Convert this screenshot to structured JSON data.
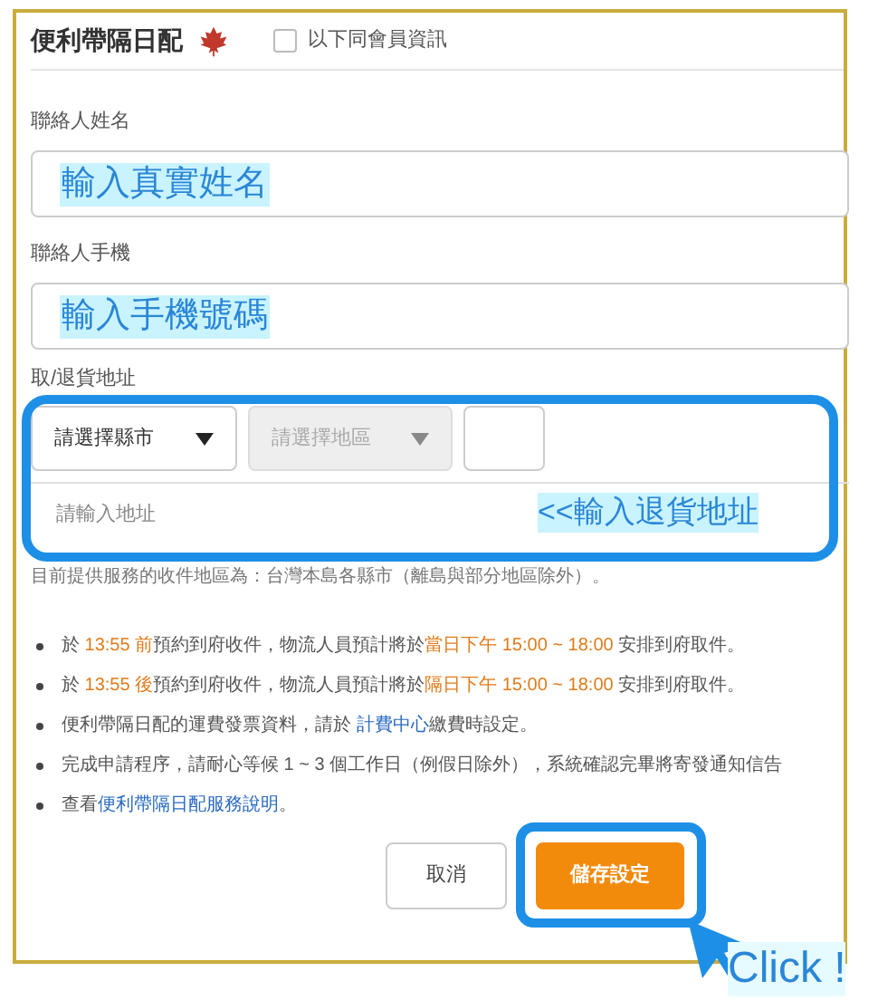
{
  "section": {
    "title": "便利帶隔日配",
    "same_as_member": {
      "label": "以下同會員資訊",
      "checked": false
    }
  },
  "name_field": {
    "label": "聯絡人姓名",
    "annotation": "輸入真實姓名"
  },
  "phone_field": {
    "label": "聯絡人手機",
    "annotation": "輸入手機號碼"
  },
  "address": {
    "label": "取/退貨地址",
    "city_select": {
      "value": "請選擇縣市",
      "disabled": false
    },
    "district_select": {
      "value": "請選擇地區",
      "disabled": true
    },
    "address_field": {
      "placeholder": "請輸入地址"
    },
    "annotation": "<<輸入退貨地址"
  },
  "service_note": "目前提供服務的收件地區為：台灣本島各縣市（離島與部分地區除外）。",
  "notes": [
    [
      {
        "text": "於 ",
        "kind": "plain"
      },
      {
        "text": "13:55 前",
        "kind": "highlight"
      },
      {
        "text": "預約到府收件，物流人員預計將於",
        "kind": "plain"
      },
      {
        "text": "當日下午 15:00 ~ 18:00",
        "kind": "highlight"
      },
      {
        "text": " 安排到府取件。",
        "kind": "plain"
      }
    ],
    [
      {
        "text": "於 ",
        "kind": "plain"
      },
      {
        "text": "13:55 後",
        "kind": "highlight"
      },
      {
        "text": "預約到府收件，物流人員預計將於",
        "kind": "plain"
      },
      {
        "text": "隔日下午 15:00 ~ 18:00",
        "kind": "highlight"
      },
      {
        "text": " 安排到府取件。",
        "kind": "plain"
      }
    ],
    [
      {
        "text": "便利帶隔日配的運費發票資料，請於 ",
        "kind": "plain"
      },
      {
        "text": "計費中心",
        "kind": "link"
      },
      {
        "text": "繳費時設定。",
        "kind": "plain"
      }
    ],
    [
      {
        "text": "完成申請程序，請耐心等候 1 ~ 3 個工作日（例假日除外），系統確認完畢將寄發通知信告",
        "kind": "plain"
      }
    ],
    [
      {
        "text": "查看",
        "kind": "plain"
      },
      {
        "text": "便利帶隔日配服務說明",
        "kind": "link"
      },
      {
        "text": "。",
        "kind": "plain"
      }
    ]
  ],
  "buttons": [
    {
      "label": "取消",
      "kind": "secondary"
    },
    {
      "label": "儲存設定",
      "kind": "primary"
    }
  ],
  "cursor_annotation": "Click !"
}
